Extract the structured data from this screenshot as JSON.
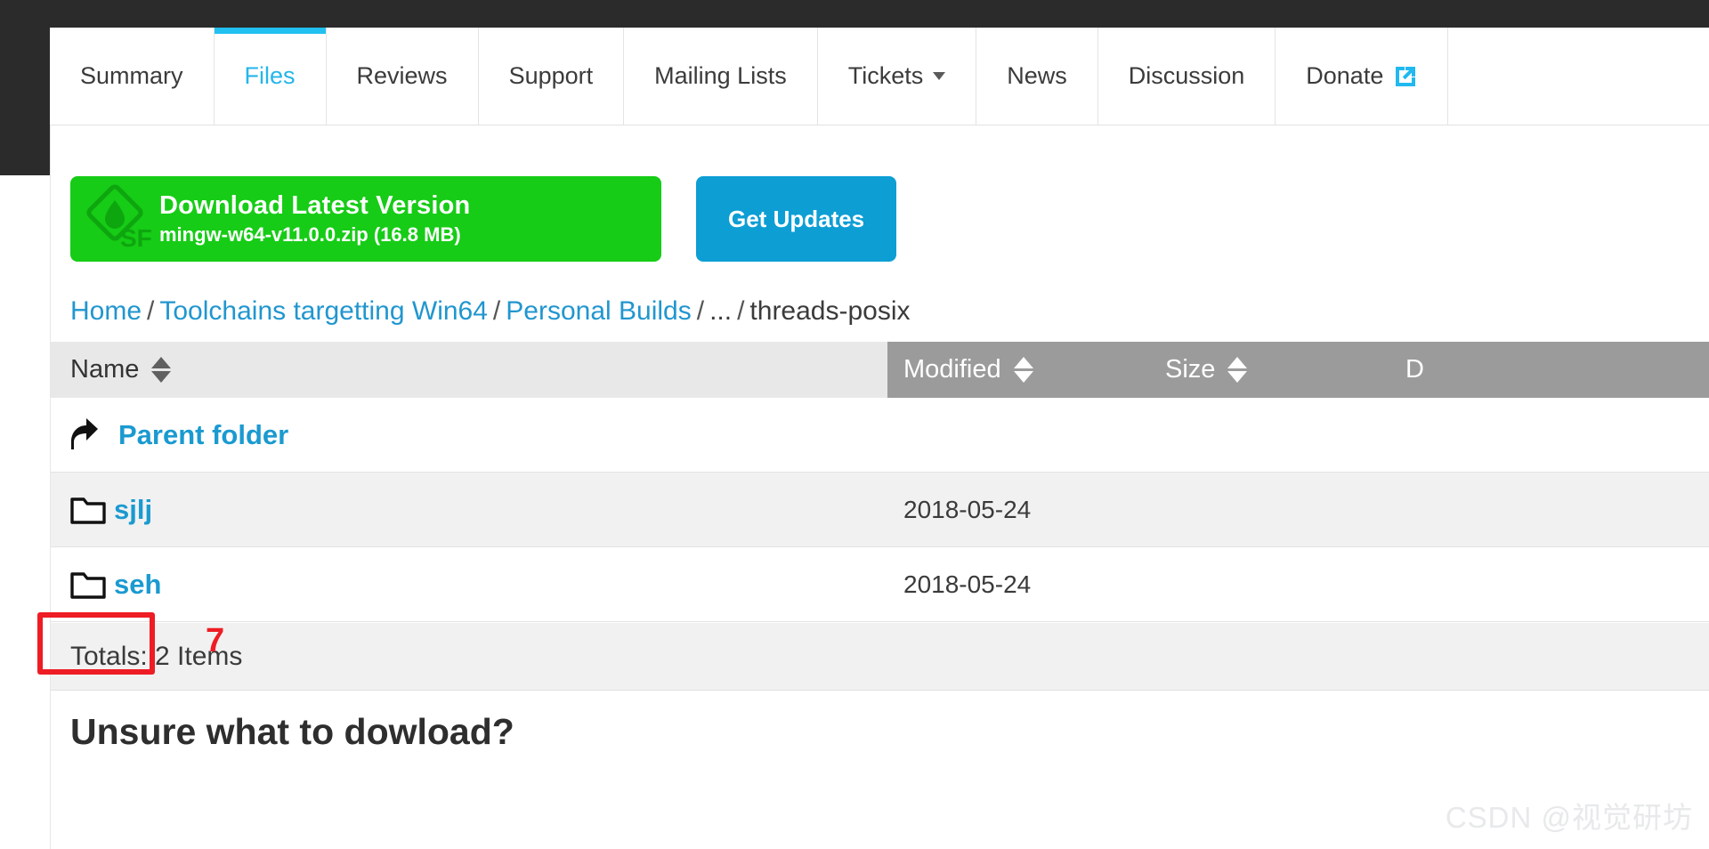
{
  "tabs": [
    {
      "label": "Summary",
      "active": false,
      "caret": false,
      "ext": false
    },
    {
      "label": "Files",
      "active": true,
      "caret": false,
      "ext": false
    },
    {
      "label": "Reviews",
      "active": false,
      "caret": false,
      "ext": false
    },
    {
      "label": "Support",
      "active": false,
      "caret": false,
      "ext": false
    },
    {
      "label": "Mailing Lists",
      "active": false,
      "caret": false,
      "ext": false
    },
    {
      "label": "Tickets",
      "active": false,
      "caret": true,
      "ext": false
    },
    {
      "label": "News",
      "active": false,
      "caret": false,
      "ext": false
    },
    {
      "label": "Discussion",
      "active": false,
      "caret": false,
      "ext": false
    },
    {
      "label": "Donate",
      "active": false,
      "caret": false,
      "ext": true
    }
  ],
  "buttons": {
    "download_title": "Download Latest Version",
    "download_subtitle": "mingw-w64-v11.0.0.zip (16.8 MB)",
    "get_updates": "Get Updates",
    "download_color": "#16cc16",
    "get_updates_color": "#0d9ed4",
    "sf_logo_icon": "sourceforge-logo-icon"
  },
  "breadcrumb": {
    "items": [
      {
        "label": "Home",
        "link": true
      },
      {
        "label": "Toolchains targetting Win64",
        "link": true
      },
      {
        "label": "Personal Builds",
        "link": true
      },
      {
        "label": "...",
        "link": false
      },
      {
        "label": "threads-posix",
        "link": false
      }
    ],
    "separator": "/"
  },
  "table": {
    "headers": {
      "name": "Name",
      "modified": "Modified",
      "size": "Size",
      "downloads": "D"
    },
    "parent_row": {
      "label": "Parent folder",
      "icon": "parent-folder-arrow-icon"
    },
    "rows": [
      {
        "name": "sjlj",
        "icon": "folder-icon",
        "modified": "2018-05-24",
        "size": "",
        "downloads": ""
      },
      {
        "name": "seh",
        "icon": "folder-icon",
        "modified": "2018-05-24",
        "size": "",
        "downloads": ""
      }
    ],
    "totals": "Totals: 2 Items",
    "header_bg_light": "#e8e8e8",
    "header_bg_dark": "#9b9b9b"
  },
  "footer": {
    "heading": "Unsure what to dowload?"
  },
  "annotations": {
    "step_number": "7",
    "color": "#ee1c24"
  },
  "watermark": {
    "text": "CSDN @视觉研坊"
  }
}
